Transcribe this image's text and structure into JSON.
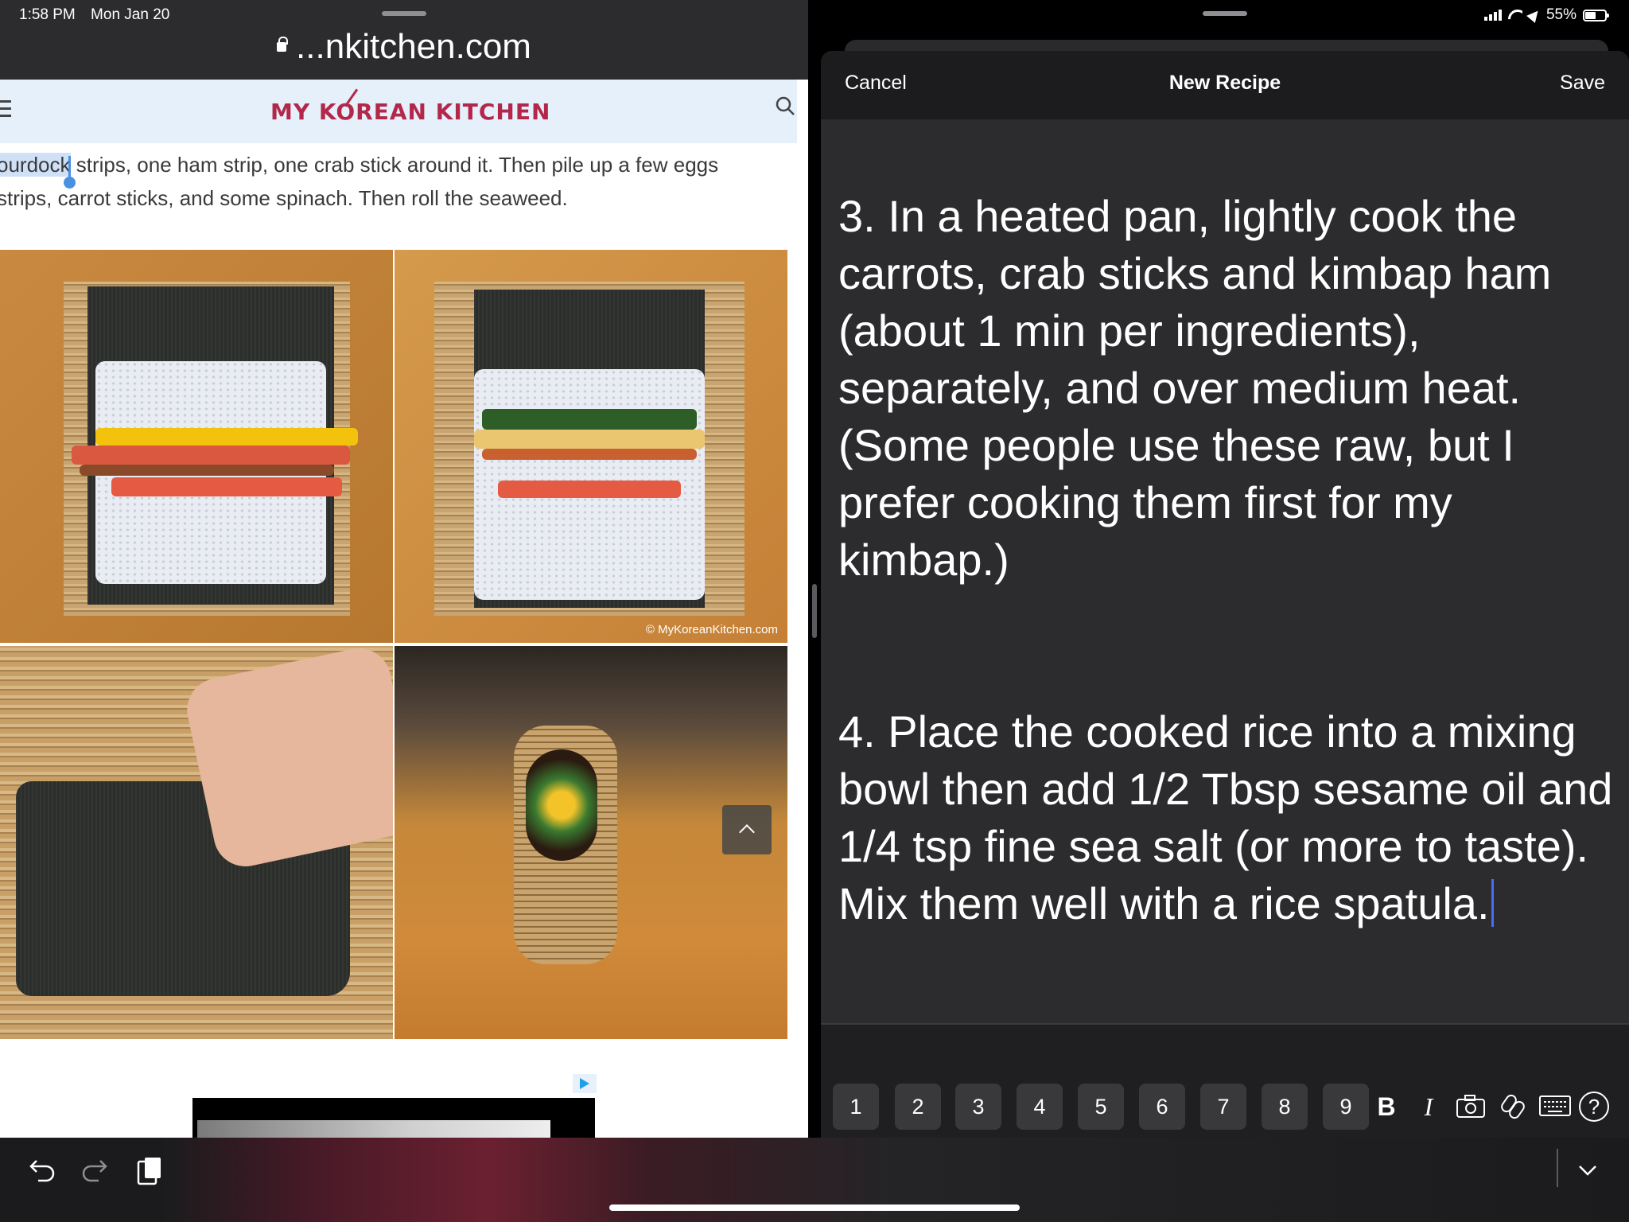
{
  "status_bar": {
    "time": "1:58 PM",
    "date": "Mon Jan 20",
    "battery_percent_label": "55%",
    "battery_level": 0.55
  },
  "safari": {
    "url": "...nkitchen.com",
    "site_logo": "MY KOREAN KITCHEN",
    "article_selected_word": "ourdock",
    "article_line1_rest": " strips, one ham strip, one crab stick around it. Then pile up a few eggs",
    "article_line2": "strips, carrot sticks, and some spinach. Then roll the seaweed.",
    "photo_credit": "© MyKoreanKitchen.com",
    "icons": [
      "menu-icon",
      "search-icon",
      "lock-icon",
      "chevron-up-icon",
      "ad-choices-icon"
    ]
  },
  "editor": {
    "cancel_label": "Cancel",
    "title": "New Recipe",
    "save_label": "Save",
    "paragraph1": "3. In a heated pan, lightly cook the carrots, crab sticks and kimbap ham (about 1 min per ingredients), separately, and over medium heat. (Some people use these raw, but I prefer cooking them first for my kimbap.)",
    "paragraph2": "4. Place the cooked rice into a mixing bowl then add 1/2 Tbsp sesame oil and 1/4 tsp fine sea salt (or more to taste). Mix them well with a rice spatula."
  },
  "keyboard_toolbar": {
    "number_keys": [
      "1",
      "2",
      "3",
      "4",
      "5",
      "6",
      "7",
      "8",
      "9"
    ],
    "bold_label": "B",
    "italic_label": "I",
    "help_label": "?",
    "icons": [
      "bold-icon",
      "italic-icon",
      "camera-icon",
      "link-icon",
      "keyboard-icon",
      "help-icon"
    ]
  },
  "shortcut_bar": {
    "icons": [
      "undo-icon",
      "redo-icon",
      "paste-icon",
      "hide-keyboard-icon"
    ]
  },
  "colors": {
    "logo": "#b3284a",
    "editor_bg": "#2c2c2e",
    "caret": "#4a6cf7",
    "selection": "#cfe0f7"
  }
}
